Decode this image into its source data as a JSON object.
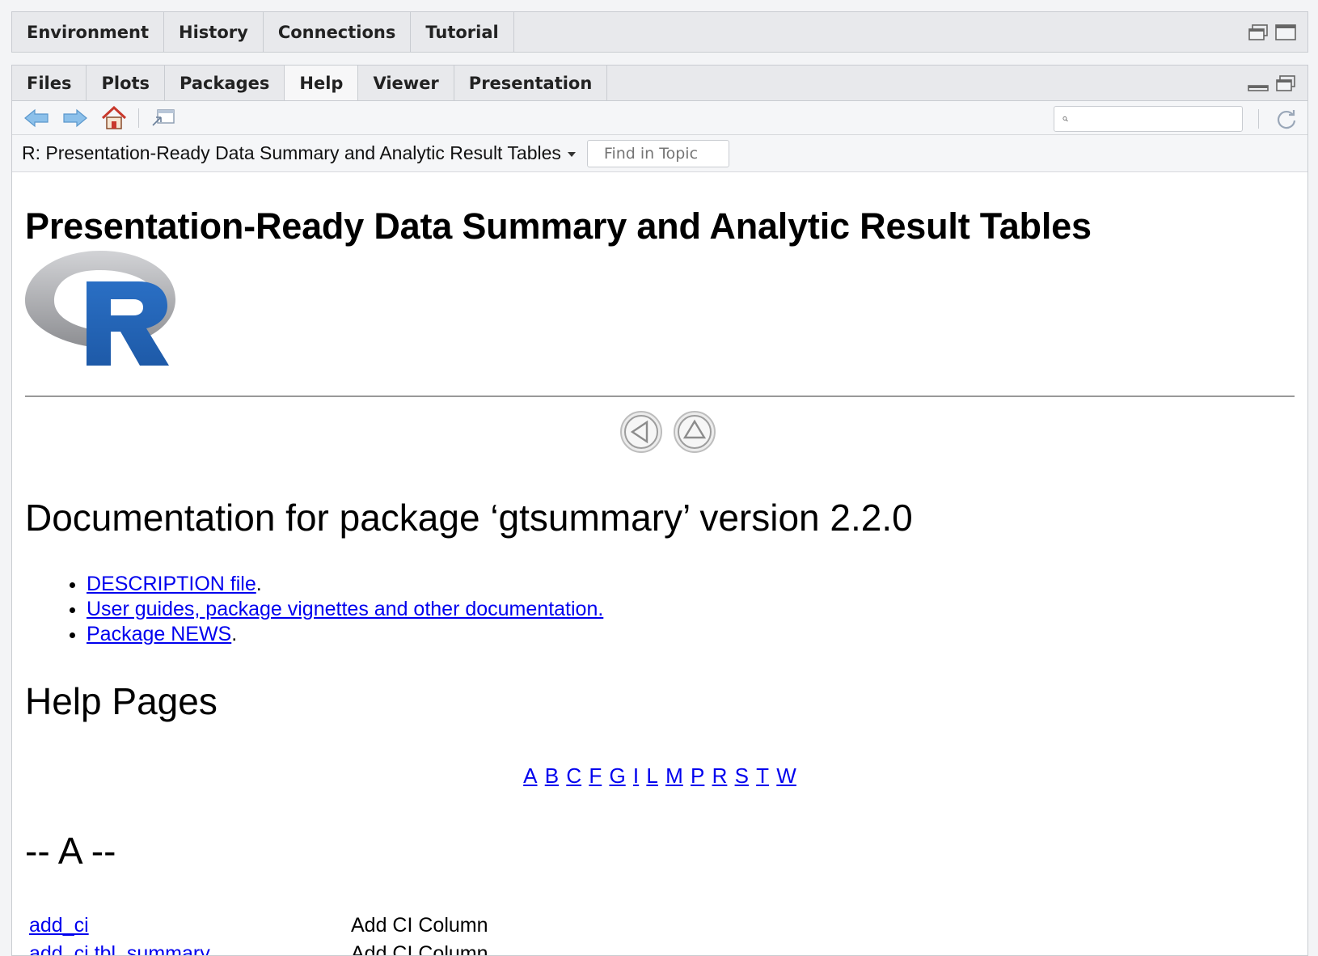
{
  "top_tabs": [
    "Environment",
    "History",
    "Connections",
    "Tutorial"
  ],
  "bottom_tabs": [
    "Files",
    "Plots",
    "Packages",
    "Help",
    "Viewer",
    "Presentation"
  ],
  "active_bottom_tab": "Help",
  "toolbar": {
    "search_placeholder": ""
  },
  "topic": {
    "selector_label": "R: Presentation-Ready Data Summary and Analytic Result Tables",
    "find_placeholder": "Find in Topic"
  },
  "page": {
    "title": "Presentation-Ready Data Summary and Analytic Result Tables",
    "doc_heading": "Documentation for package ‘gtsummary’ version 2.2.0",
    "links": [
      {
        "text": "DESCRIPTION file",
        "suffix": "."
      },
      {
        "text": "User guides, package vignettes and other documentation.",
        "suffix": ""
      },
      {
        "text": "Package NEWS",
        "suffix": "."
      }
    ],
    "help_heading": "Help Pages",
    "alphabet": [
      "A",
      "B",
      "C",
      "F",
      "G",
      "I",
      "L",
      "M",
      "P",
      "R",
      "S",
      "T",
      "W"
    ],
    "section_heading": "-- A --",
    "functions": [
      {
        "name": "add_ci",
        "desc": "Add CI Column"
      },
      {
        "name": "add_ci.tbl_summary",
        "desc": "Add CI Column"
      }
    ]
  },
  "colors": {
    "link": "#0000ee",
    "r_blue": "#2165b6",
    "r_gray": "#a8a9ad"
  }
}
